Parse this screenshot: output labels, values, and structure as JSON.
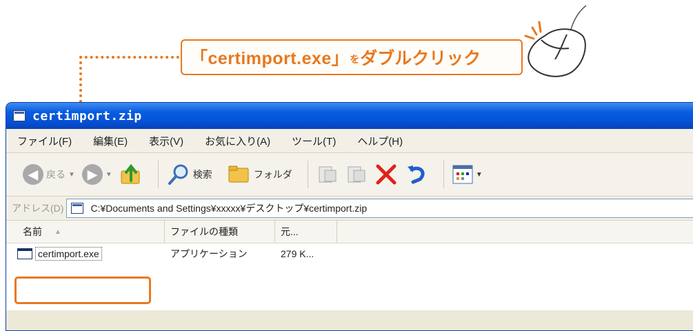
{
  "callout": {
    "filename": "「certimport.exe」",
    "particle": "を",
    "action": "ダブルクリック"
  },
  "window": {
    "title": "certimport.zip",
    "menu": [
      "ファイル(F)",
      "編集(E)",
      "表示(V)",
      "お気に入り(A)",
      "ツール(T)",
      "ヘルプ(H)"
    ],
    "toolbar": {
      "back_label": "戻る",
      "search_label": "検索",
      "folders_label": "フォルダ"
    },
    "address": {
      "label": "アドレス(D)",
      "value": "C:¥Documents and Settings¥xxxxx¥デスクトップ¥certimport.zip"
    },
    "columns": [
      "名前",
      "ファイルの種類",
      "元..."
    ],
    "files": [
      {
        "name": "certimport.exe",
        "type": "アプリケーション",
        "size": "279 K..."
      }
    ]
  },
  "colors": {
    "accent": "#e8781e",
    "titlebar": "#0a5de0",
    "window_bg": "#ece9d8"
  },
  "icons": [
    "mouse-icon",
    "zip-folder-icon",
    "back-icon",
    "forward-icon",
    "up-folder-icon",
    "search-icon",
    "folders-icon",
    "move-to-icon",
    "copy-to-icon",
    "delete-icon",
    "undo-icon",
    "views-icon",
    "exe-file-icon"
  ]
}
